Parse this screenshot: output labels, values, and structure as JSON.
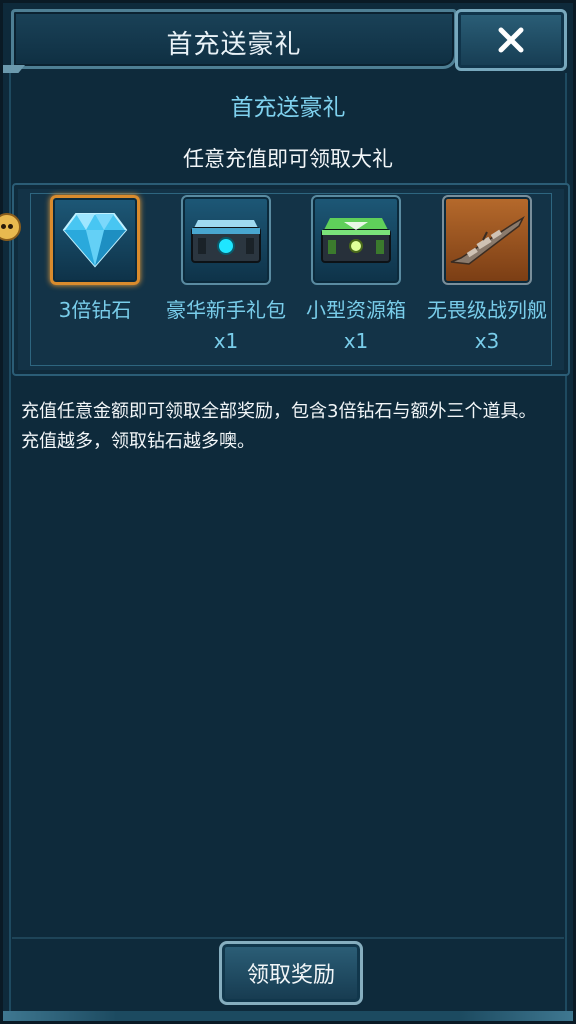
{
  "header": {
    "title": "首充送豪礼",
    "close_icon": "close-icon"
  },
  "main": {
    "subtitle": "首充送豪礼",
    "tagline": "任意充值即可领取大礼",
    "rewards": [
      {
        "label": "3倍钻石",
        "icon": "diamond-icon"
      },
      {
        "label": "豪华新手礼包 x1",
        "icon": "luxury-chest-icon"
      },
      {
        "label": "小型资源箱 x1",
        "icon": "resource-box-icon"
      },
      {
        "label": "无畏级战列舰 x3",
        "icon": "battleship-icon"
      }
    ],
    "description_line1": "充值任意金额即可领取全部奖励，包含3倍钻石与额外三个道具。",
    "description_line2": "充值越多，领取钻石越多噢。"
  },
  "footer": {
    "claim_label": "领取奖励"
  },
  "colors": {
    "background": "#0e2a3b",
    "accent": "#79cdea",
    "gold": "#d98b2d"
  }
}
